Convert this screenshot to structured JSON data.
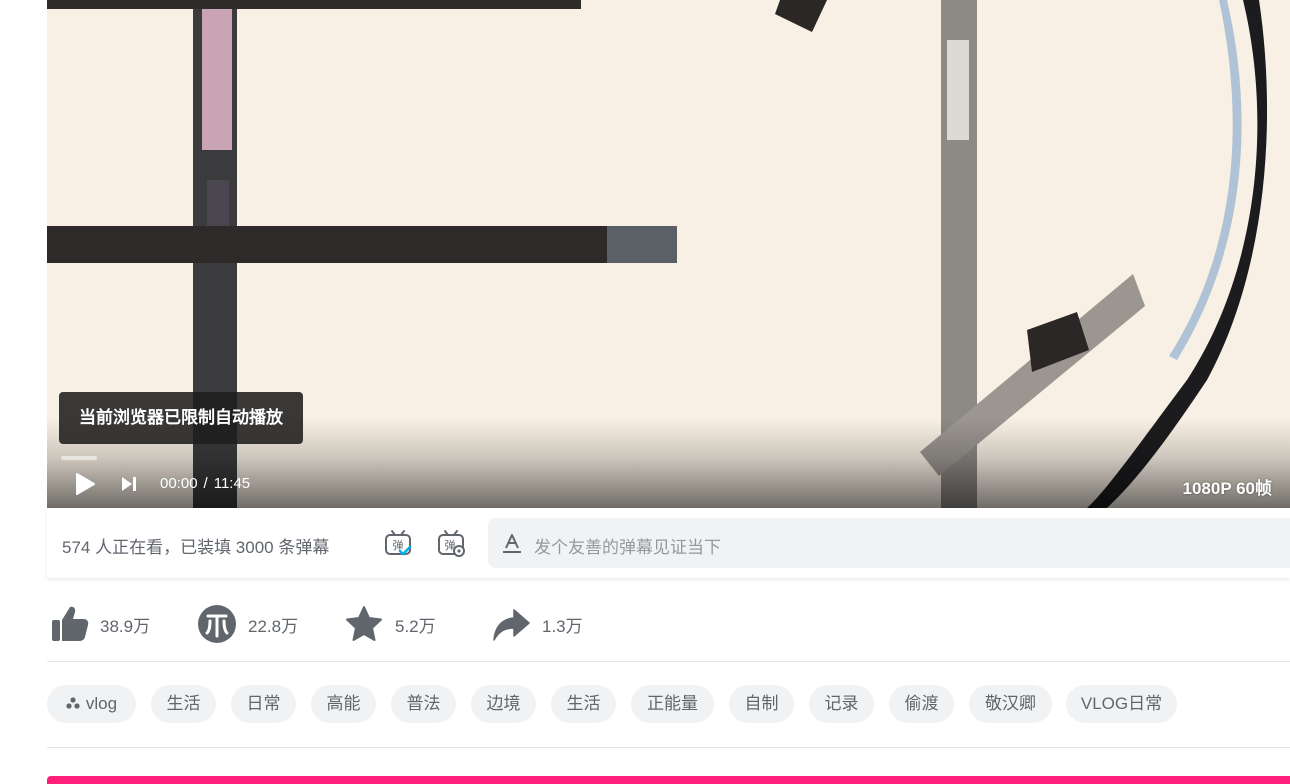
{
  "player": {
    "autoplay_notice": "当前浏览器已限制自动播放",
    "current_time": "00:00",
    "time_separator": "/",
    "duration": "11:45",
    "quality": "1080P 60帧",
    "progress_fraction": 0
  },
  "danmaku": {
    "viewers_text": "574 人正在看，已装填 3000 条弹幕",
    "toggle_icon": "danmaku-on-icon",
    "settings_icon": "danmaku-settings-icon",
    "input_placeholder": "发个友善的弹幕见证当下"
  },
  "actions": {
    "like": "38.9万",
    "coin": "22.8万",
    "favorite": "5.2万",
    "share": "1.3万"
  },
  "tags": [
    "vlog",
    "生活",
    "日常",
    "高能",
    "普法",
    "边境",
    "生活",
    "正能量",
    "自制",
    "记录",
    "偷渡",
    "敬汉卿",
    "VLOG日常"
  ],
  "colors": {
    "icon_gray": "#61666d",
    "danmaku_blue": "#00aeec",
    "chip_bg": "#f1f2f3",
    "accent_pink": "#ff1f7a"
  }
}
